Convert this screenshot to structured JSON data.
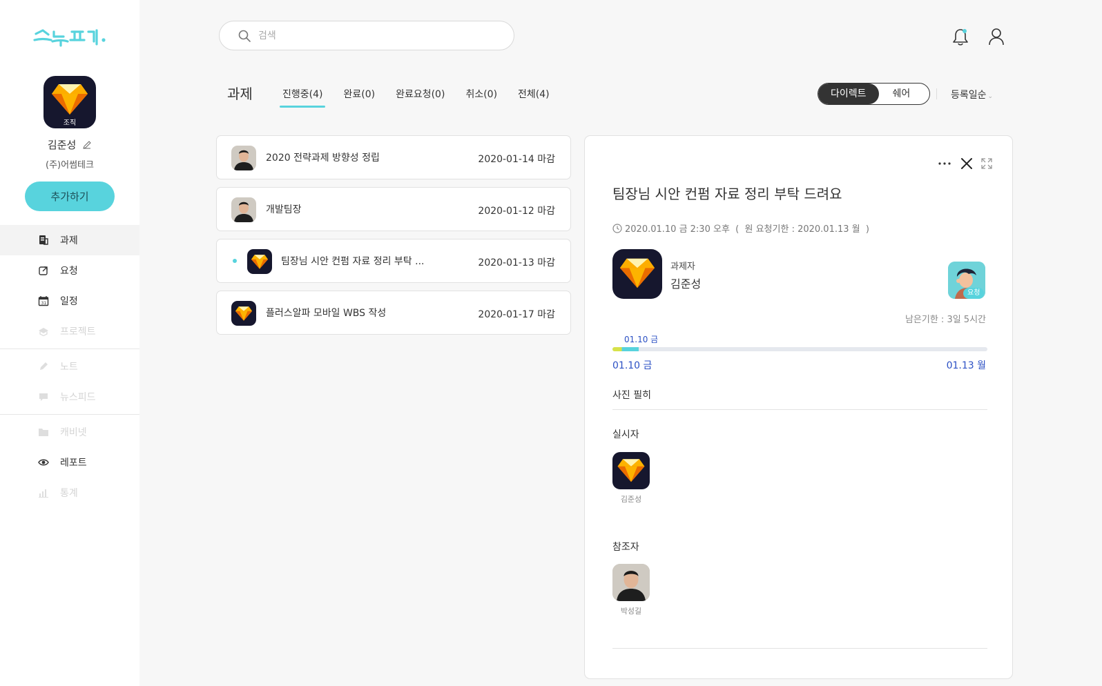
{
  "app": {
    "logo_text": "스누퍼."
  },
  "sidebar": {
    "org_tag": "조직",
    "user_name": "김준성",
    "company": "(주)어썸테크",
    "add_button": "추가하기",
    "items": [
      {
        "label": "과제",
        "icon": "task-icon",
        "state": "active"
      },
      {
        "label": "요청",
        "icon": "request-icon",
        "state": "normal"
      },
      {
        "label": "일정",
        "icon": "calendar-icon",
        "state": "normal"
      },
      {
        "label": "프로젝트",
        "icon": "project-icon",
        "state": "disabled"
      },
      {
        "label": "노트",
        "icon": "pen-icon",
        "state": "disabled"
      },
      {
        "label": "뉴스피드",
        "icon": "chat-icon",
        "state": "disabled"
      },
      {
        "label": "캐비넷",
        "icon": "folder-icon",
        "state": "disabled"
      },
      {
        "label": "레포트",
        "icon": "eye-icon",
        "state": "normal"
      },
      {
        "label": "통계",
        "icon": "chart-icon",
        "state": "disabled"
      }
    ]
  },
  "search": {
    "placeholder": "검색"
  },
  "header": {
    "title": "과제",
    "tabs": [
      "진행중(4)",
      "완료(0)",
      "완료요청(0)",
      "취소(0)",
      "전체(4)"
    ],
    "active_tab": 0,
    "toggle": {
      "on": "다이렉트",
      "off": "쉐어"
    },
    "sort": "등록일순"
  },
  "tasks": [
    {
      "title": "2020 전략과제 방향성 정립",
      "due": "2020-01-14 마감",
      "avatar": "person-photo",
      "unread": false
    },
    {
      "title": "개발팀장",
      "due": "2020-01-12 마감",
      "avatar": "person-photo",
      "unread": false
    },
    {
      "title": "팀장님 시안 컨펌 자료 정리 부탁 ...",
      "due": "2020-01-13 마감",
      "avatar": "diamond-icon",
      "unread": true
    },
    {
      "title": "플러스알파 모바일 WBS 작성",
      "due": "2020-01-17 마감",
      "avatar": "diamond-icon",
      "unread": false
    }
  ],
  "detail": {
    "title": "팀장님 시안 컨펌 자료 정리 부탁 드려요",
    "meta": "2020.01.10 금 2:30 오후  (  원 요청기한 : 2020.01.13 월  )",
    "assignee_label": "과제자",
    "assignee_name": "김준성",
    "request_badge": "요청",
    "remaining": "남은기한 : 3일 5시간",
    "progress": {
      "tip": "01.10 금",
      "start": "01.10 금",
      "end": "01.13 월",
      "elapsed_fraction": 0.07
    },
    "body": "사진 필히",
    "executor_label": "실시자",
    "executor_name": "김준성",
    "participant_label": "참조자",
    "participant_name": "박성길"
  },
  "colors": {
    "accent": "#58d3dd",
    "date_blue": "#2b50c4",
    "app_icon_bg": "#16172e"
  }
}
